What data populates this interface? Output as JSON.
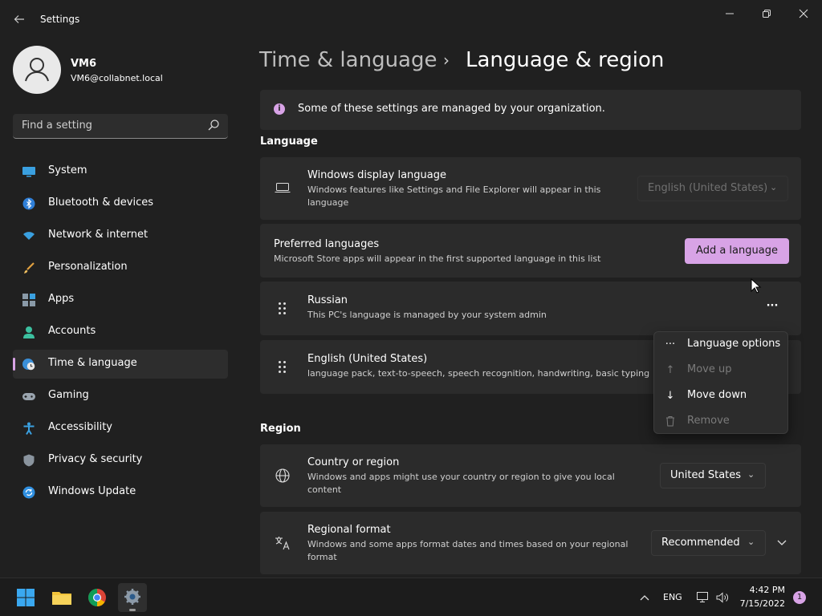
{
  "window": {
    "title": "Settings"
  },
  "user": {
    "name": "VM6",
    "email": "VM6@collabnet.local"
  },
  "search": {
    "placeholder": "Find a setting"
  },
  "sidebar": {
    "items": [
      {
        "label": "System",
        "icon": "monitor-icon"
      },
      {
        "label": "Bluetooth & devices",
        "icon": "bluetooth-icon"
      },
      {
        "label": "Network & internet",
        "icon": "wifi-icon"
      },
      {
        "label": "Personalization",
        "icon": "brush-icon"
      },
      {
        "label": "Apps",
        "icon": "apps-icon"
      },
      {
        "label": "Accounts",
        "icon": "person-icon"
      },
      {
        "label": "Time & language",
        "icon": "clock-globe-icon",
        "active": true
      },
      {
        "label": "Gaming",
        "icon": "gamepad-icon"
      },
      {
        "label": "Accessibility",
        "icon": "accessibility-icon"
      },
      {
        "label": "Privacy & security",
        "icon": "shield-icon"
      },
      {
        "label": "Windows Update",
        "icon": "update-icon"
      }
    ]
  },
  "breadcrumb": {
    "parent": "Time & language",
    "separator": "›",
    "current": "Language & region"
  },
  "notice": {
    "text": "Some of these settings are managed by your organization."
  },
  "language": {
    "section_title": "Language",
    "display": {
      "title": "Windows display language",
      "desc": "Windows features like Settings and File Explorer will appear in this language",
      "value": "English (United States)"
    },
    "preferred": {
      "title": "Preferred languages",
      "desc": "Microsoft Store apps will appear in the first supported language in this list",
      "add_label": "Add a language"
    },
    "list": [
      {
        "name": "Russian",
        "desc": "This PC's language is managed by your system admin"
      },
      {
        "name": "English (United States)",
        "desc": "language pack, text-to-speech, speech recognition, handwriting, basic typing"
      }
    ],
    "more_label": "···"
  },
  "context_menu": {
    "items": [
      {
        "label": "Language options",
        "icon": "more-icon",
        "glyph": "···",
        "enabled": true
      },
      {
        "label": "Move up",
        "icon": "arrow-up-icon",
        "glyph": "↑",
        "enabled": false
      },
      {
        "label": "Move down",
        "icon": "arrow-down-icon",
        "glyph": "↓",
        "enabled": true
      },
      {
        "label": "Remove",
        "icon": "trash-icon",
        "glyph": "🗑",
        "enabled": false
      }
    ]
  },
  "region": {
    "section_title": "Region",
    "country": {
      "title": "Country or region",
      "desc": "Windows and apps might use your country or region to give you local content",
      "value": "United States"
    },
    "format": {
      "title": "Regional format",
      "desc": "Windows and some apps format dates and times based on your regional format",
      "value": "Recommended"
    }
  },
  "taskbar": {
    "lang": "ENG",
    "time": "4:42 PM",
    "date": "7/15/2022",
    "notif_count": "1"
  },
  "colors": {
    "accent": "#d8a3e6",
    "background": "#202020",
    "card": "#2b2b2b"
  }
}
